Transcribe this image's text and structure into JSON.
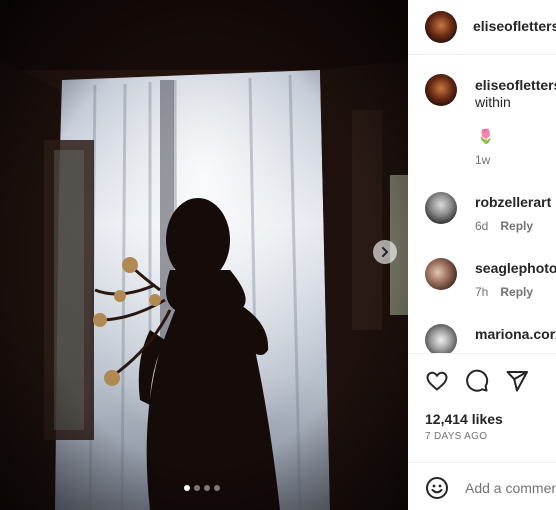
{
  "post": {
    "author": "eliseofletters"
  },
  "caption": {
    "author": "eliseofletters",
    "text": "within",
    "emoji": "🌷",
    "time": "1w"
  },
  "comments": [
    {
      "user": "robzellerart",
      "time": "6d",
      "reply_label": "Reply"
    },
    {
      "user": "seaglephotog",
      "time": "7h",
      "reply_label": "Reply"
    },
    {
      "user": "mariona.corx",
      "time": "",
      "reply_label": ""
    }
  ],
  "actions": {
    "like_icon": "heart-icon",
    "comment_icon": "comment-icon",
    "share_icon": "send-icon"
  },
  "stats": {
    "likes": "12,414 likes",
    "posted": "7 DAYS AGO"
  },
  "add_comment": {
    "placeholder": "Add a commen"
  },
  "carousel": {
    "total": 4,
    "active": 1
  }
}
